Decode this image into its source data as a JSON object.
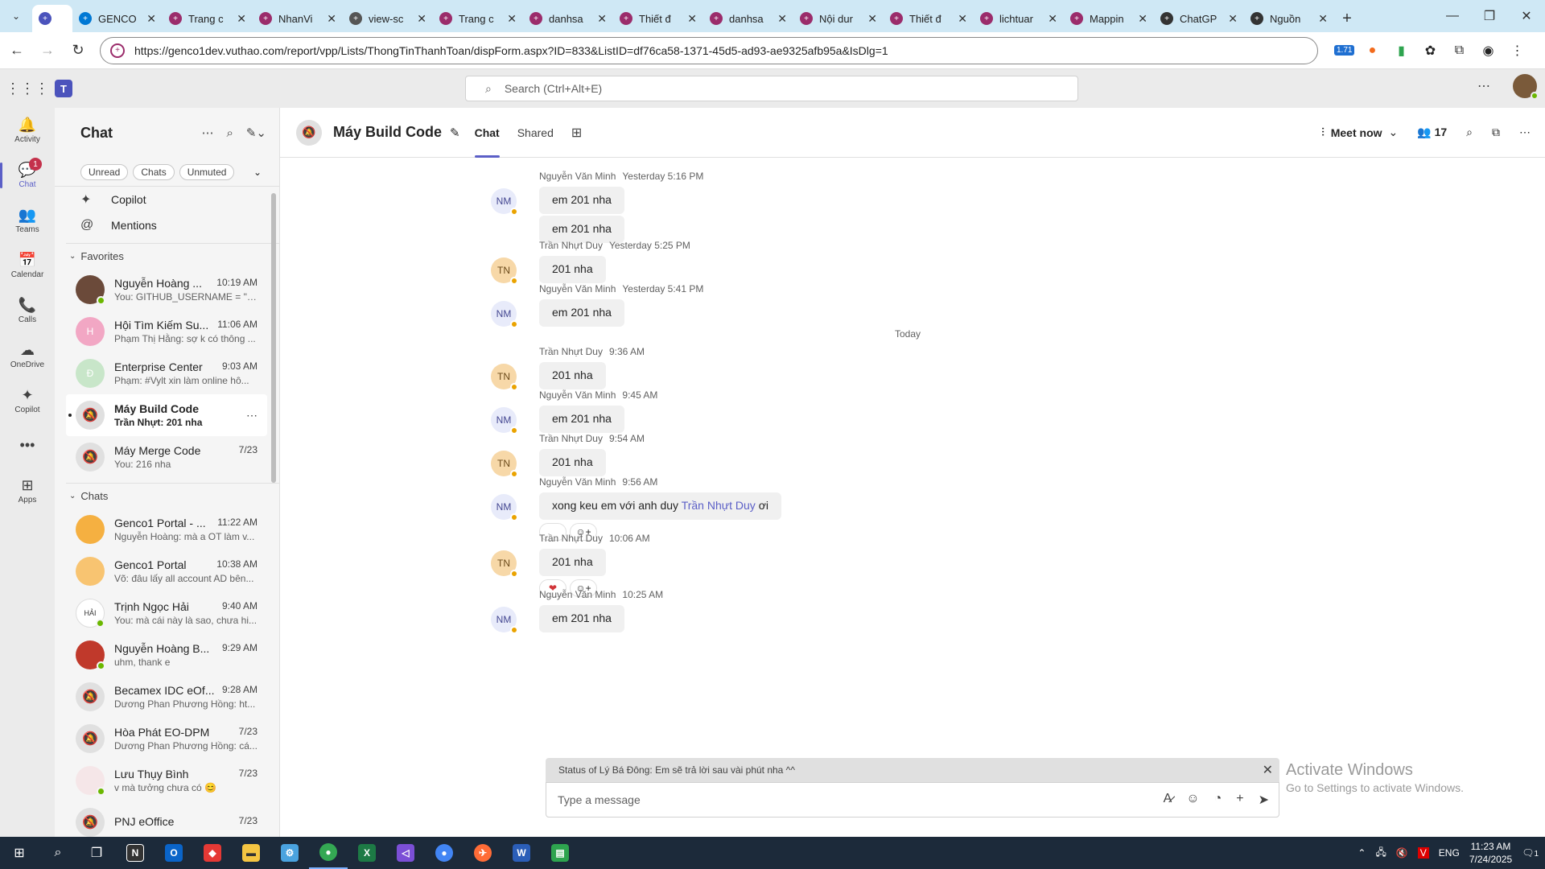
{
  "browser": {
    "tabs": [
      {
        "title": "",
        "color": "#4b53bc",
        "active": true
      },
      {
        "title": "GENCO",
        "color": "#0078d4"
      },
      {
        "title": "Trang c",
        "color": "#9b2c6b"
      },
      {
        "title": "NhanVi",
        "color": "#9b2c6b"
      },
      {
        "title": "view-sc",
        "color": "#555555"
      },
      {
        "title": "Trang c",
        "color": "#9b2c6b"
      },
      {
        "title": "danhsa",
        "color": "#9b2c6b"
      },
      {
        "title": "Thiết đ",
        "color": "#9b2c6b"
      },
      {
        "title": "danhsa",
        "color": "#9b2c6b"
      },
      {
        "title": "Nội dur",
        "color": "#9b2c6b"
      },
      {
        "title": "Thiết đ",
        "color": "#9b2c6b"
      },
      {
        "title": "lichtuar",
        "color": "#9b2c6b"
      },
      {
        "title": "Mappin",
        "color": "#9b2c6b"
      },
      {
        "title": "ChatGP",
        "color": "#333333"
      },
      {
        "title": "Nguồn",
        "color": "#333333"
      }
    ],
    "url": "https://genco1dev.vuthao.com/report/vpp/Lists/ThongTinThanhToan/dispForm.aspx?ID=833&ListID=df76ca58-1371-45d5-ad93-ae9325afb95a&IsDlg=1",
    "ext_badge": "1.71"
  },
  "teams": {
    "search_placeholder": "Search (Ctrl+Alt+E)"
  },
  "rail": [
    {
      "label": "Activity",
      "icon": "🔔"
    },
    {
      "label": "Chat",
      "icon": "💬",
      "badge": "1",
      "active": true
    },
    {
      "label": "Teams",
      "icon": "👥"
    },
    {
      "label": "Calendar",
      "icon": "📅"
    },
    {
      "label": "Calls",
      "icon": "📞"
    },
    {
      "label": "OneDrive",
      "icon": "☁"
    },
    {
      "label": "Copilot",
      "icon": "✦"
    },
    {
      "label": "",
      "icon": "•••"
    },
    {
      "label": "Apps",
      "icon": "⊞"
    }
  ],
  "chatpane": {
    "title": "Chat",
    "filters": [
      "Unread",
      "Chats",
      "Unmuted"
    ],
    "nav": [
      {
        "label": "Copilot",
        "icon": "✦"
      },
      {
        "label": "Mentions",
        "icon": "@"
      }
    ],
    "favorites_label": "Favorites",
    "chats_label": "Chats",
    "favorites": [
      {
        "name": "Nguyễn Hoàng ...",
        "time": "10:19 AM",
        "preview": "You: GITHUB_USERNAME = \"n...",
        "avatar": "#6b4a3a",
        "initials": "",
        "status": true
      },
      {
        "name": "Hội Tìm Kiếm Su...",
        "time": "11:06 AM",
        "preview": "Phạm Thị Hằng: sợ k có thông ...",
        "avatar": "#f2a7c4",
        "initials": "H",
        "status": false
      },
      {
        "name": "Enterprise Center",
        "time": "9:03 AM",
        "preview": "Phạm: #Vylt xin làm online hô...",
        "avatar": "#c8e6c9",
        "initials": "Đ",
        "status": false
      },
      {
        "name": "Máy Build Code",
        "time": "",
        "preview": "Trần Nhựt: 201 nha",
        "avatar": "muted",
        "initials": "🔕",
        "selected": true,
        "bold": true
      },
      {
        "name": "Máy Merge Code",
        "time": "7/23",
        "preview": "You: 216  nha",
        "avatar": "muted",
        "initials": "🔕"
      }
    ],
    "chats": [
      {
        "name": "Genco1 Portal - ...",
        "time": "11:22 AM",
        "preview": "Nguyễn Hoàng: mà a OT làm v...",
        "avatar": "#f5b041",
        "initials": ""
      },
      {
        "name": "Genco1 Portal",
        "time": "10:38 AM",
        "preview": "Võ: đâu lấy all account AD bên...",
        "avatar": "#f8c471",
        "initials": ""
      },
      {
        "name": "Trịnh Ngọc Hải",
        "time": "9:40 AM",
        "preview": "You: mà cái này là sao, chưa hi...",
        "avatar": "#ffffff",
        "initials": "HẢI",
        "status": true
      },
      {
        "name": "Nguyễn Hoàng B...",
        "time": "9:29 AM",
        "preview": "uhm, thank e",
        "avatar": "#c0392b",
        "initials": "",
        "status": true
      },
      {
        "name": "Becamex IDC eOf...",
        "time": "9:28 AM",
        "preview": "Dương Phan Phương Hồng: ht...",
        "avatar": "muted",
        "initials": "🔕"
      },
      {
        "name": "Hòa Phát EO-DPM",
        "time": "7/23",
        "preview": "Dương Phan Phương Hồng: cá...",
        "avatar": "muted",
        "initials": "🔕"
      },
      {
        "name": "Lưu Thụy Bình",
        "time": "7/23",
        "preview": "v mà tưởng chưa có 😊",
        "avatar": "#f5e6e8",
        "initials": "",
        "status": true
      },
      {
        "name": "PNJ eOffice",
        "time": "7/23",
        "preview": "",
        "avatar": "muted",
        "initials": "🔕"
      }
    ]
  },
  "conversation": {
    "title": "Máy Build Code",
    "tabs": [
      "Chat",
      "Shared"
    ],
    "meet_label": "Meet now",
    "participants": "17",
    "today_label": "Today",
    "messages": [
      {
        "author": "Nguyễn Văn Minh",
        "time": "Yesterday 5:16 PM",
        "initials": "NM",
        "kind": "nm",
        "lines": [
          "em 201 nha",
          "em 201 nha"
        ]
      },
      {
        "author": "Trần Nhựt Duy",
        "time": "Yesterday 5:25 PM",
        "initials": "TN",
        "kind": "tn",
        "lines": [
          "201 nha"
        ]
      },
      {
        "author": "Nguyễn Văn Minh",
        "time": "Yesterday 5:41 PM",
        "initials": "NM",
        "kind": "nm",
        "lines": [
          "em 201 nha"
        ]
      },
      {
        "author": "Trần Nhựt Duy",
        "time": "9:36 AM",
        "initials": "TN",
        "kind": "tn",
        "lines": [
          "201 nha"
        ]
      },
      {
        "author": "Nguyễn Văn Minh",
        "time": "9:45 AM",
        "initials": "NM",
        "kind": "nm",
        "lines": [
          "em 201 nha"
        ]
      },
      {
        "author": "Trần Nhựt Duy",
        "time": "9:54 AM",
        "initials": "TN",
        "kind": "tn",
        "lines": [
          "201 nha"
        ]
      },
      {
        "author": "Nguyễn Văn Minh",
        "time": "9:56 AM",
        "initials": "NM",
        "kind": "nm",
        "lines": [
          "xong keu em với anh duy"
        ],
        "mention": "Trần Nhựt Duy",
        "suffix": " ơi",
        "reactions": [
          "",
          "☺+"
        ]
      },
      {
        "author": "Trần Nhựt Duy",
        "time": "10:06 AM",
        "initials": "TN",
        "kind": "tn",
        "lines": [
          "201 nha"
        ],
        "reactions": [
          "❤",
          "☺+"
        ]
      },
      {
        "author": "Nguyễn Văn Minh",
        "time": "10:25 AM",
        "initials": "NM",
        "kind": "nm",
        "lines": [
          "em 201 nha"
        ]
      }
    ],
    "status_note": "Status of Lý Bá Đông: Em sẽ trả lời sau vài phút nha ^^",
    "composer_placeholder": "Type a message"
  },
  "watermark": {
    "line1": "Activate Windows",
    "line2": "Go to Settings to activate Windows."
  },
  "taskbar": {
    "lang": "ENG",
    "time": "11:23 AM",
    "date": "7/24/2025",
    "notif": "1"
  }
}
